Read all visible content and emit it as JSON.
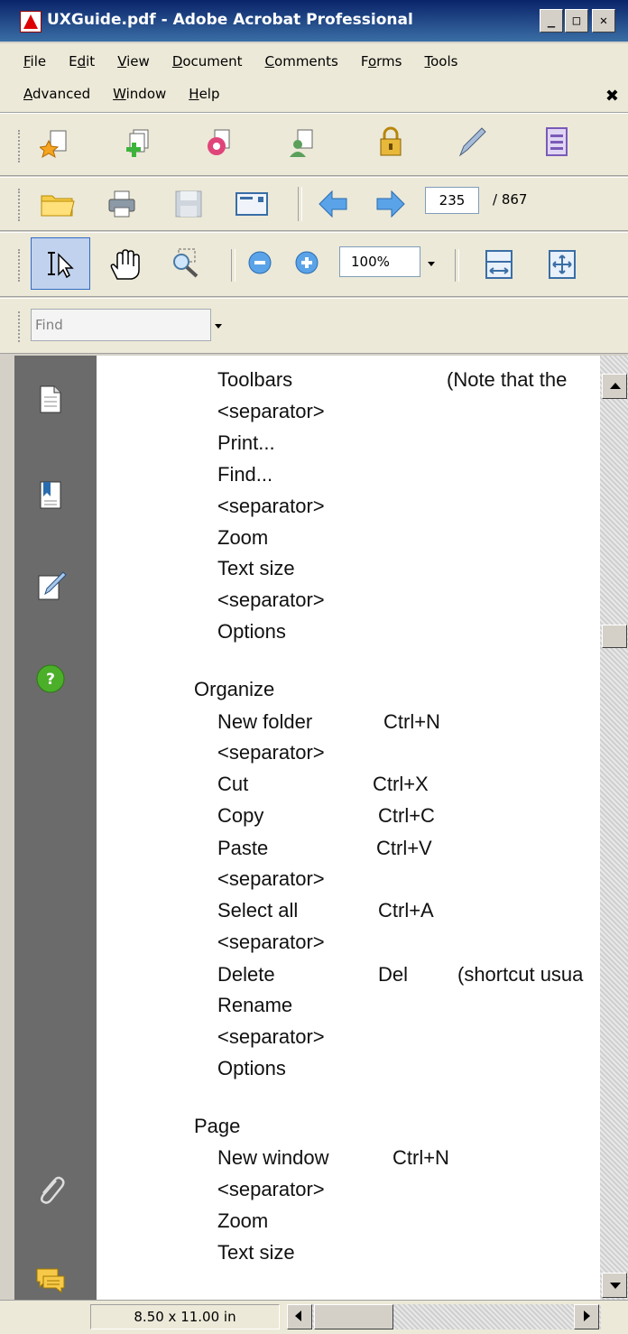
{
  "window": {
    "title": "UXGuide.pdf - Adobe Acrobat Professional",
    "min": "_",
    "max": "□",
    "close": "✕"
  },
  "menu": {
    "row1": [
      {
        "acc": "F",
        "rest": "ile"
      },
      {
        "pre": "E",
        "acc": "d",
        "rest": "it"
      },
      {
        "acc": "V",
        "rest": "iew"
      },
      {
        "acc": "D",
        "rest": "ocument"
      },
      {
        "acc": "C",
        "rest": "omments"
      },
      {
        "pre": "F",
        "acc": "o",
        "rest": "rms"
      },
      {
        "acc": "T",
        "rest": "ools"
      }
    ],
    "row2": [
      {
        "acc": "A",
        "rest": "dvanced"
      },
      {
        "acc": "W",
        "rest": "indow"
      },
      {
        "acc": "H",
        "rest": "elp"
      }
    ],
    "close_doc": "✖"
  },
  "nav": {
    "current_page": "235",
    "total_pages": "/ 867"
  },
  "zoom": {
    "value": "100%"
  },
  "find": {
    "placeholder": "Find"
  },
  "document": {
    "lines": [
      {
        "text": "Toolbars",
        "indent": 1,
        "bold": false
      },
      {
        "text": "(Note that the",
        "indent": 1,
        "bold": false,
        "col": 2
      },
      {
        "text": "<separator>",
        "indent": 1
      },
      {
        "text": "Print...",
        "indent": 1
      },
      {
        "text": "Find...",
        "indent": 1
      },
      {
        "text": "<separator>",
        "indent": 1
      },
      {
        "text": "Zoom",
        "indent": 1
      },
      {
        "text": "Text size",
        "indent": 1
      },
      {
        "text": "<separator>",
        "indent": 1
      },
      {
        "text": "Options",
        "indent": 1
      },
      {
        "text": "Organize",
        "indent": 0
      },
      {
        "text": "New folder",
        "indent": 1
      },
      {
        "text": "Ctrl+N",
        "indent": 1,
        "col": 1
      },
      {
        "text": "<separator>",
        "indent": 1
      },
      {
        "text": "Cut",
        "indent": 1
      },
      {
        "text": "Ctrl+X",
        "indent": 1,
        "col": 1
      },
      {
        "text": "Copy",
        "indent": 1
      },
      {
        "text": "Ctrl+C",
        "indent": 1,
        "col": 1
      },
      {
        "text": "Paste",
        "indent": 1
      },
      {
        "text": "Ctrl+V",
        "indent": 1,
        "col": 1
      },
      {
        "text": "<separator>",
        "indent": 1
      },
      {
        "text": "Select all",
        "indent": 1
      },
      {
        "text": "Ctrl+A",
        "indent": 1,
        "col": 1
      },
      {
        "text": "<separator>",
        "indent": 1
      },
      {
        "text": "Delete",
        "indent": 1
      },
      {
        "text": "Del",
        "indent": 1,
        "col": 1
      },
      {
        "text": "(shortcut usua",
        "indent": 1,
        "col": 2
      },
      {
        "text": "Rename",
        "indent": 1
      },
      {
        "text": "<separator>",
        "indent": 1
      },
      {
        "text": "Options",
        "indent": 1
      },
      {
        "text": "Page",
        "indent": 0
      },
      {
        "text": "New window",
        "indent": 1
      },
      {
        "text": "Ctrl+N",
        "indent": 1,
        "col": 1
      },
      {
        "text": "<separator>",
        "indent": 1
      },
      {
        "text": "Zoom",
        "indent": 1
      },
      {
        "text": "Text size",
        "indent": 1
      }
    ]
  },
  "status": {
    "page_size": "8.50 x 11.00 in"
  },
  "icons": {
    "toolbar1": [
      "create-pdf-icon",
      "combine-files-icon",
      "export-icon",
      "review-icon",
      "secure-icon",
      "sign-icon",
      "forms-icon"
    ],
    "toolbar2": [
      "open-folder-icon",
      "print-icon",
      "save-icon",
      "email-icon",
      "previous-page-icon",
      "next-page-icon"
    ],
    "toolbar3": [
      "select-tool-icon",
      "hand-tool-icon",
      "zoom-marquee-icon",
      "zoom-out-icon",
      "zoom-in-icon",
      "fit-width-icon",
      "fit-page-icon"
    ],
    "navpane": [
      "pages-icon",
      "bookmarks-icon",
      "signatures-icon",
      "help-icon",
      "attachments-icon",
      "comments-icon"
    ]
  }
}
